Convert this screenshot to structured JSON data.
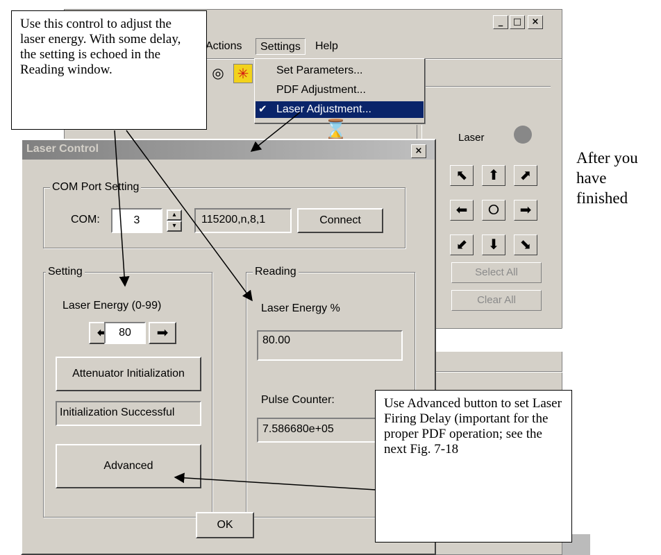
{
  "window": {
    "buttons": [
      "_",
      "□",
      "×"
    ]
  },
  "menubar": {
    "items": [
      "Actions",
      "Settings",
      "Help"
    ]
  },
  "settings_menu": {
    "items": [
      "Set Parameters...",
      "PDF Adjustment...",
      "Laser Adjustment..."
    ],
    "checked_item": "Laser Adjustment...",
    "check_glyph": "✔"
  },
  "toolbar": {
    "icons": [
      "target-icon",
      "laser-star-icon"
    ],
    "glyphs": [
      "◎",
      "✳"
    ]
  },
  "right_panel": {
    "laser_label": "Laser",
    "arrows": [
      "⬉",
      "⬆",
      "⬈",
      "⬅",
      "⭘",
      "➡",
      "⬋",
      "⬇",
      "⬊"
    ],
    "select_all": "Select All",
    "clear_all": "Clear All"
  },
  "dialog": {
    "title": "Laser Control",
    "close": "×",
    "com_group": {
      "legend": "COM Port Setting",
      "com_label": "COM:",
      "com_value": "3",
      "spinner_up": "▴",
      "spinner_down": "▾",
      "baud": "115200,n,8,1",
      "connect": "Connect"
    },
    "setting_group": {
      "legend": "Setting",
      "energy_label": "Laser Energy (0-99)",
      "energy_value": "80",
      "dec_glyph": "⬅",
      "inc_glyph": "➡",
      "attenuator_button": "Attenuator Initialization",
      "status": "Initialization Successful",
      "advanced_button": "Advanced"
    },
    "reading_group": {
      "legend": "Reading",
      "energy_label": "Laser Energy %",
      "energy_value": "80.00",
      "pulse_label": "Pulse Counter:",
      "pulse_value": "7.586680e+05"
    },
    "ok_button": "OK"
  },
  "callouts": {
    "top_left": "Use this control to adjust the laser energy. With some delay, the setting is echoed in the Reading window.",
    "bottom_right": "Use Advanced button to set Laser Firing Delay (important for the proper PDF operation; see the next Fig. 7-18",
    "side": "After you have finished"
  },
  "colors": {
    "dialog_face": "#d4d0c8",
    "menu_highlight": "#0a246a",
    "laser_led": "#888888"
  }
}
